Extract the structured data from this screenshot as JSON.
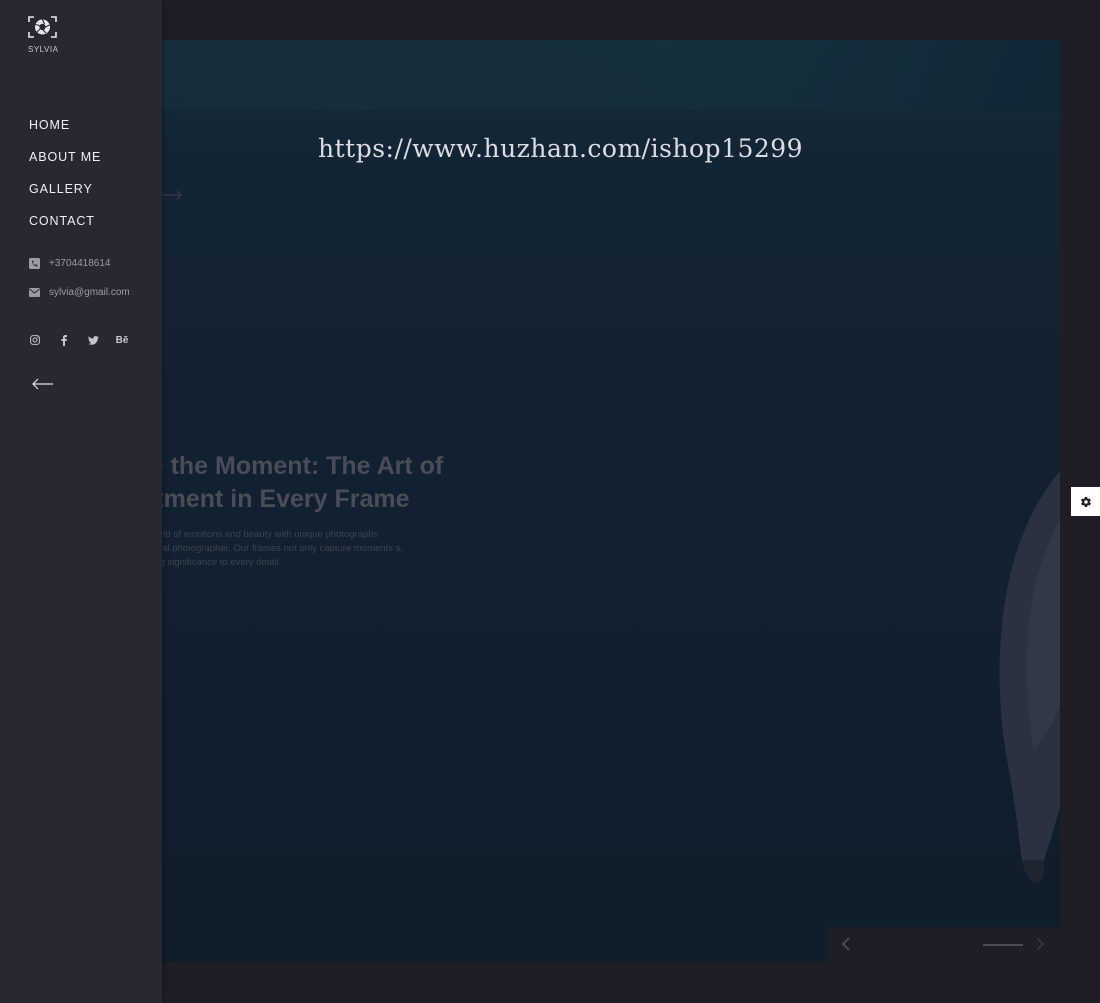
{
  "logo": {
    "name": "SYLVIA",
    "icon": "camera-aperture-icon"
  },
  "nav": [
    {
      "label": "HOME"
    },
    {
      "label": "ABOUT ME"
    },
    {
      "label": "GALLERY"
    },
    {
      "label": "CONTACT"
    }
  ],
  "contact": {
    "phone": "+3704418614",
    "email": "sylvia@gmail.com",
    "phone_icon": "phone-icon",
    "email_icon": "envelope-icon"
  },
  "social": [
    {
      "name": "instagram-icon"
    },
    {
      "name": "facebook-icon"
    },
    {
      "name": "twitter-icon"
    },
    {
      "name": "behance-icon",
      "label": "Bē"
    }
  ],
  "hero": {
    "title": "re the Moment: The Art of\nntment in Every Frame",
    "description": "a world of emotions and beauty with unique photographs ssional photographer. Our frames not only capture moments s, giving significance to every detail."
  },
  "watermark": "https://www.huzhan.com/ishop15299",
  "colors": {
    "sidebar_bg": "#282833",
    "page_bg": "#1e1e27",
    "hero_overlay": "#182c3e",
    "settings_bg": "#ffffff"
  }
}
